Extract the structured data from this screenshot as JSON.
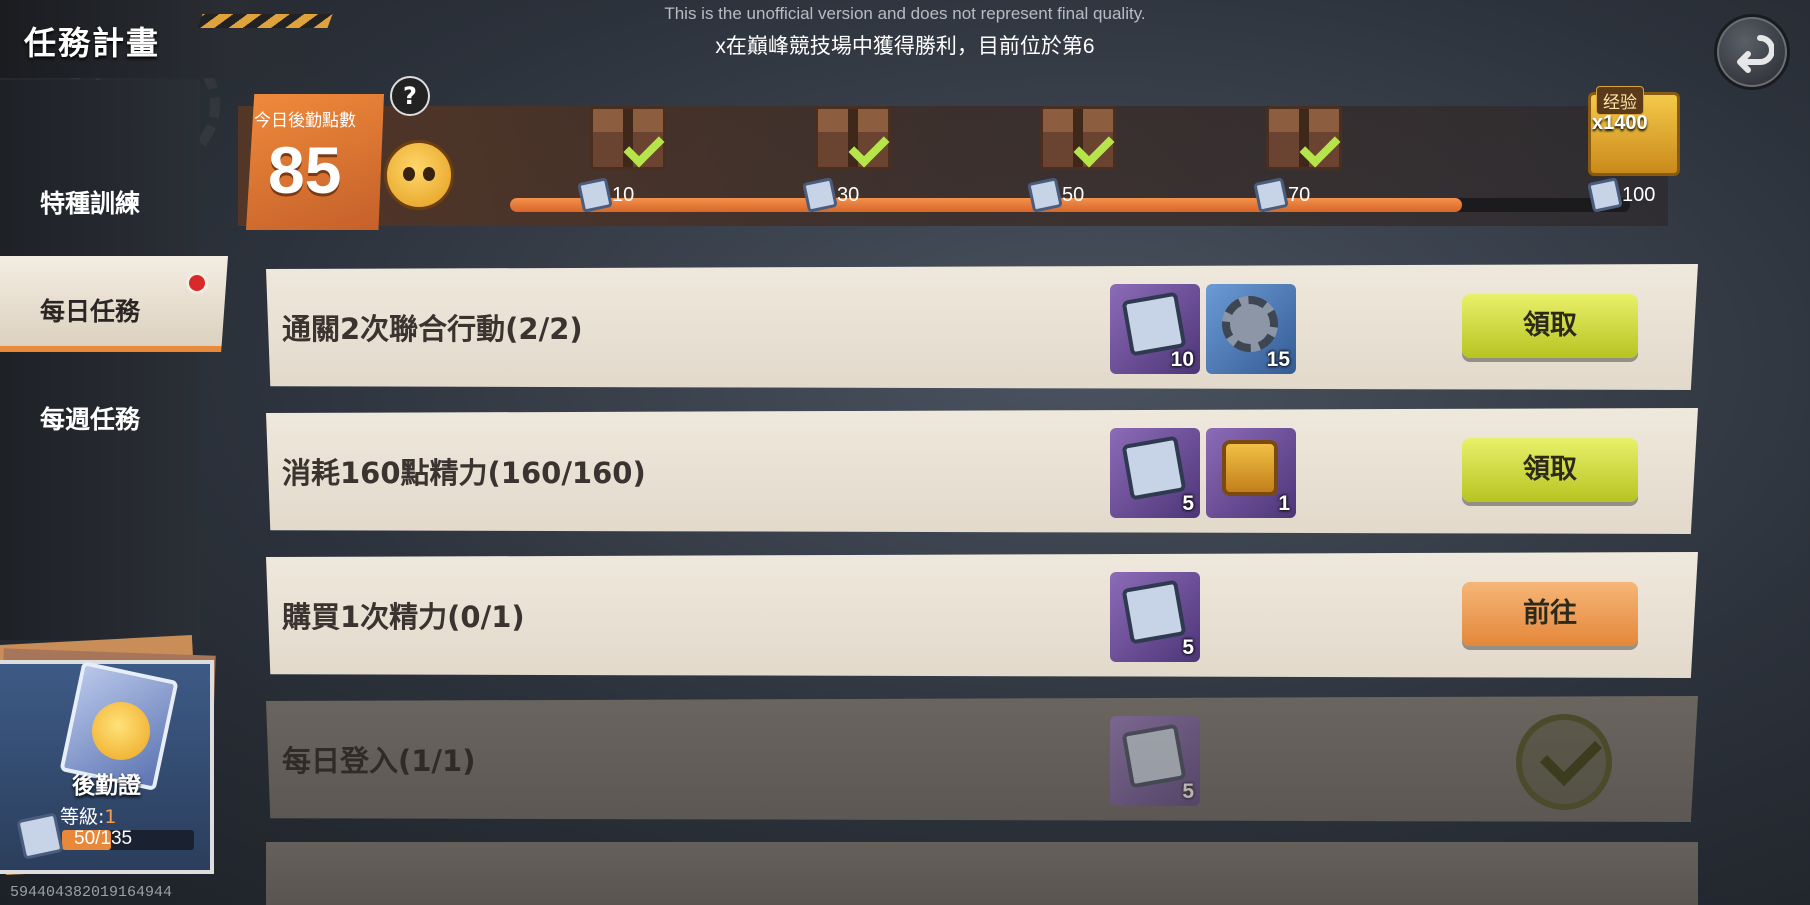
{
  "header": {
    "title": "任務計畫",
    "notice": "This is the unofficial version and does not represent final quality.",
    "broadcast": "x在巔峰競技場中獲得勝利，目前位於第6",
    "back_icon": "back-arrow-icon"
  },
  "points": {
    "label": "今日後勤點數",
    "value": "85",
    "help": "?"
  },
  "progress": {
    "fraction": 0.85,
    "milestones": [
      {
        "threshold": "10",
        "claimed": true
      },
      {
        "threshold": "30",
        "claimed": true
      },
      {
        "threshold": "50",
        "claimed": true
      },
      {
        "threshold": "70",
        "claimed": true
      },
      {
        "threshold": "100",
        "claimed": false
      }
    ],
    "grand_reward": {
      "tag": "经验",
      "qty": "x1400"
    }
  },
  "nav": {
    "items": [
      {
        "label": "特種訓練"
      },
      {
        "label": "每日任務"
      },
      {
        "label": "每週任務"
      }
    ]
  },
  "logistics": {
    "title": "後勤證",
    "level_label": "等級:",
    "level": "1",
    "xp": "50/135",
    "xp_fraction": 0.37
  },
  "uid": "5944043820191649​44",
  "tasks": [
    {
      "name": "通關2次聯合行動(2/2)",
      "rewards": [
        {
          "icon": "logistics-token-icon",
          "qty": "10"
        },
        {
          "icon": "gear-material-icon",
          "qty": "15"
        }
      ],
      "action": "領取",
      "state": "claim"
    },
    {
      "name": "消耗160點精力(160/160)",
      "rewards": [
        {
          "icon": "logistics-token-icon",
          "qty": "5"
        },
        {
          "icon": "gold-chest-icon",
          "qty": "1"
        }
      ],
      "action": "領取",
      "state": "claim"
    },
    {
      "name": "購買1次精力(0/1)",
      "rewards": [
        {
          "icon": "logistics-token-icon",
          "qty": "5"
        }
      ],
      "action": "前往",
      "state": "goto"
    },
    {
      "name": "每日登入(1/1)",
      "rewards": [
        {
          "icon": "logistics-token-icon",
          "qty": "5"
        }
      ],
      "action": "",
      "state": "done"
    }
  ]
}
